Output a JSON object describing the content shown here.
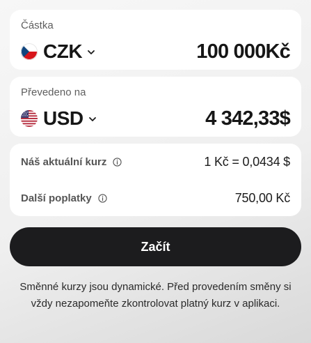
{
  "amount": {
    "label": "Částka",
    "currency": {
      "code": "CZK",
      "flag_icon": "czech-flag-icon"
    },
    "value": "100 000Kč"
  },
  "converted": {
    "label": "Převedeno na",
    "currency": {
      "code": "USD",
      "flag_icon": "us-flag-icon"
    },
    "value": "4 342,33$"
  },
  "rates": {
    "rate_label": "Náš aktuální kurz",
    "rate_value": "1 Kč = 0,0434 $",
    "fees_label": "Další poplatky",
    "fees_value": "750,00 Kč"
  },
  "actions": {
    "start_label": "Začít"
  },
  "disclaimer": "Směnné kurzy jsou dynamické. Před provedením směny si vždy nezapomeňte zkontrolovat platný kurz v aplikaci.",
  "colors": {
    "button_bg": "#1c1c1e",
    "card_bg": "#ffffff",
    "label_gray": "#5e5e5e"
  }
}
